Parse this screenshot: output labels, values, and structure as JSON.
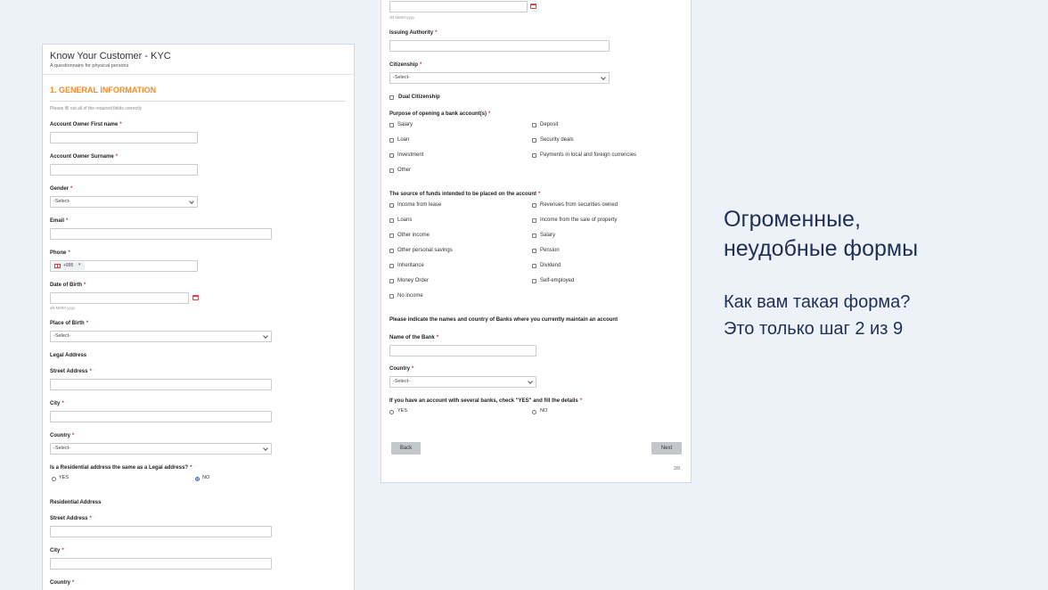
{
  "form1": {
    "title": "Know Your Customer - KYC",
    "subtitle": "A questionnaire for physical persons",
    "section_title": "1. GENERAL INFORMATION",
    "instructions": "Please fill out all of the required fields correctly",
    "first_name_label": "Account Owner First name",
    "surname_label": "Account Owner Surname",
    "gender_label": "Gender",
    "select_placeholder": "-Select-",
    "email_label": "Email",
    "phone_label": "Phone",
    "phone_code": "+995",
    "dob_label": "Date of Birth",
    "date_hint": "dd-MMM-yyyy",
    "pob_label": "Place of Birth",
    "legal_address_heading": "Legal Address",
    "street_label": "Street Address",
    "city_label": "City",
    "country_label": "Country",
    "same_address_question": "Is a Residential address the same as a Legal address?",
    "yes": "YES",
    "no": "NO",
    "same_address_selected": "NO",
    "residential_heading": "Residential Address",
    "required_mark": "*"
  },
  "form2": {
    "date_hint": "dd-MMM-yyyy",
    "issuing_authority_label": "Issuing Authority",
    "citizenship_label": "Citizenship",
    "select_placeholder": "-Select-",
    "dual_citizenship_label": "Dual Citizenship",
    "purpose_label": "Purpose of opening a bank account(s)",
    "purpose_options": [
      "Salary",
      "Deposit",
      "Loan",
      "Security deals",
      "Investment",
      "Payments in local and foreign currencies",
      "Other"
    ],
    "funds_label": "The source of funds intended to be placed on the account",
    "funds_options": [
      "Income from lease",
      "Revenues from securities owned",
      "Loans",
      "Income from the sale of property",
      "Other income",
      "Salary",
      "Other personal savings",
      "Pension",
      "Inheritance",
      "Dividend",
      "Money Order",
      "Self-employed",
      "No income"
    ],
    "banks_instruction": "Please indicate the names and country of Banks where you currently maintain an account",
    "bank_name_label": "Name of the Bank",
    "country_label": "Country",
    "several_banks_question": "If you have an account with several banks, check \"YES\" and fill the details",
    "yes": "YES",
    "no": "NO",
    "back_button": "Back",
    "next_button": "Next",
    "page_indicator": "2/9",
    "required_mark": "*"
  },
  "slide": {
    "heading_line1": "Огроменные,",
    "heading_line2": "неудобные формы",
    "text_line1": "Как вам такая форма?",
    "text_line2": "Это только шаг 2 из 9"
  },
  "colors": {
    "background": "#edf1f8",
    "section_title": "#f28c28",
    "required": "#dd3333",
    "radio_selected": "#3d6fd6",
    "side_text": "#1f2f55",
    "button": "#c3c6cb"
  }
}
